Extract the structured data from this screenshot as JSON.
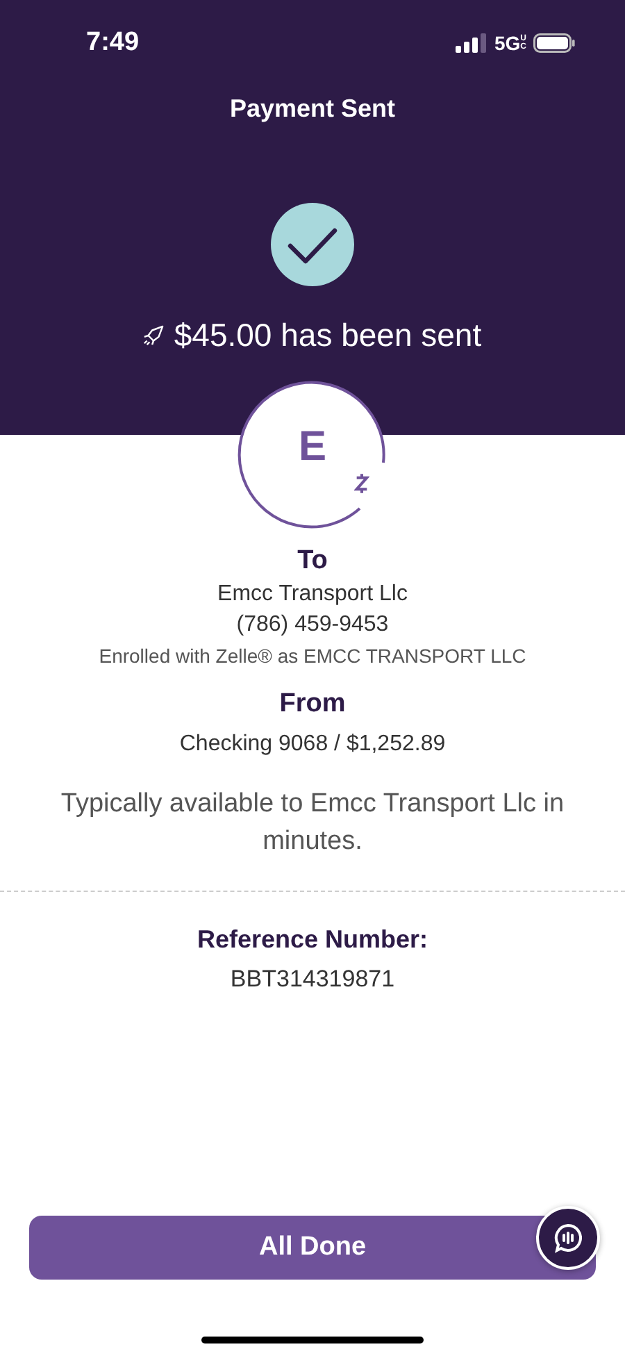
{
  "status_bar": {
    "time": "7:49",
    "network": "5G",
    "network_badge": "UC"
  },
  "header": {
    "title": "Payment Sent",
    "amount_message": "$45.00 has been sent"
  },
  "recipient": {
    "initial": "E",
    "label": "To",
    "name": "Emcc Transport Llc",
    "phone": "(786) 459-9453",
    "enrollment": "Enrolled with Zelle® as EMCC TRANSPORT LLC"
  },
  "source": {
    "label": "From",
    "account": "Checking 9068 / $1,252.89"
  },
  "availability": "Typically available to Emcc Transport Llc in minutes.",
  "reference": {
    "label": "Reference Number:",
    "value": "BBT314319871"
  },
  "buttons": [
    {
      "label": "All Done",
      "kind": "primary"
    }
  ]
}
